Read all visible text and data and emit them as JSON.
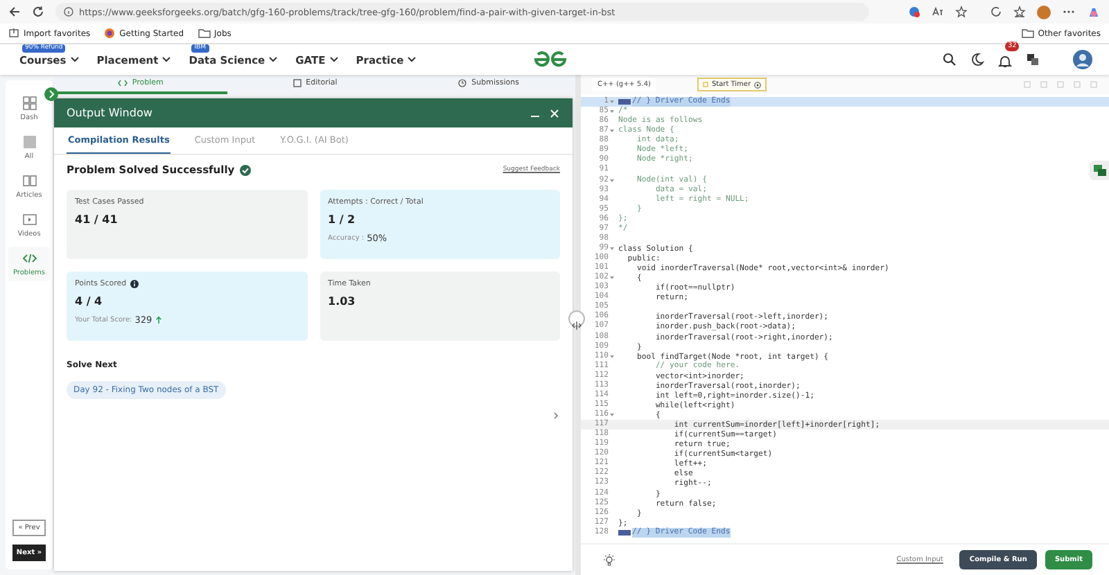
{
  "browser": {
    "url": "https://www.geeksforgeeks.org/batch/gfg-160-problems/track/tree-gfg-160/problem/find-a-pair-with-given-target-in-bst",
    "bookmarks": [
      {
        "label": "Import favorites",
        "kind": "import"
      },
      {
        "label": "Getting Started",
        "kind": "site"
      },
      {
        "label": "Jobs",
        "kind": "folder"
      }
    ],
    "other_bookmarks": "Other favorites"
  },
  "nav": {
    "items": [
      {
        "label": "Courses",
        "badge": "90% Refund"
      },
      {
        "label": "Placement"
      },
      {
        "label": "Data Science",
        "badge": "IBM"
      },
      {
        "label": "GATE"
      },
      {
        "label": "Practice"
      }
    ],
    "notification_count": "32"
  },
  "sidebar": {
    "items": [
      {
        "label": "Dash",
        "selected": false
      },
      {
        "label": "All",
        "selected": false
      },
      {
        "label": "Articles",
        "selected": false
      },
      {
        "label": "Videos",
        "selected": false
      },
      {
        "label": "Problems",
        "selected": true
      }
    ],
    "prev": "« Prev",
    "next": "Next »"
  },
  "problem_tabs": [
    {
      "label": "Problem",
      "selected": true
    },
    {
      "label": "Editorial",
      "selected": false
    },
    {
      "label": "Submissions",
      "selected": false
    }
  ],
  "output_window": {
    "title": "Output Window",
    "tabs": [
      {
        "label": "Compilation Results",
        "selected": true
      },
      {
        "label": "Custom Input",
        "selected": false
      },
      {
        "label": "Y.O.G.I. (AI Bot)",
        "selected": false
      }
    ],
    "status": "Problem Solved Successfully",
    "feedback_link": "Suggest Feedback",
    "cards": [
      {
        "label": "Test Cases Passed",
        "value": "41 / 41",
        "highlighted": false,
        "info": false
      },
      {
        "label": "Attempts : Correct / Total",
        "value": "1 / 2",
        "highlighted": true,
        "info": false,
        "note_label": "Accuracy :",
        "note_value": "50%",
        "trend_up": false
      },
      {
        "label": "Points Scored",
        "value": "4 / 4",
        "highlighted": true,
        "info": true,
        "note_label": "Your Total Score:",
        "note_value": "329",
        "trend_up": true
      },
      {
        "label": "Time Taken",
        "value": "1.03",
        "highlighted": false,
        "info": false
      }
    ],
    "solve_next": {
      "heading": "Solve Next",
      "items": [
        "Day 92 - Fixing Two nodes of a BST"
      ]
    }
  },
  "editor": {
    "language": "C++ (g++ 5.4)",
    "timer_button": "Start Timer",
    "custom_input": "Custom Input",
    "compile_button": "Compile & Run",
    "submit_button": "Submit",
    "lines": [
      {
        "num": "1",
        "text": "// } Driver Code Ends",
        "kind": "folded",
        "foldable": true,
        "highlighted": true,
        "cursor": false
      },
      {
        "num": "85",
        "text": "/*",
        "kind": "comment",
        "foldable": true,
        "highlighted": false,
        "cursor": false
      },
      {
        "num": "86",
        "text": "Node is as follows",
        "kind": "comment",
        "foldable": false,
        "highlighted": false,
        "cursor": false
      },
      {
        "num": "87",
        "text": "class Node {",
        "kind": "comment",
        "foldable": true,
        "highlighted": false,
        "cursor": false
      },
      {
        "num": "88",
        "text": "    int data;",
        "kind": "comment",
        "foldable": false,
        "highlighted": false,
        "cursor": false
      },
      {
        "num": "89",
        "text": "    Node *left;",
        "kind": "comment",
        "foldable": false,
        "highlighted": false,
        "cursor": false
      },
      {
        "num": "90",
        "text": "    Node *right;",
        "kind": "comment",
        "foldable": false,
        "highlighted": false,
        "cursor": false
      },
      {
        "num": "91",
        "kind": "comment",
        "foldable": false,
        "highlighted": false,
        "cursor": false
      },
      {
        "num": "92",
        "text": "    Node(int val) {",
        "kind": "comment",
        "foldable": true,
        "highlighted": false,
        "cursor": false
      },
      {
        "num": "93",
        "text": "        data = val;",
        "kind": "comment",
        "foldable": false,
        "highlighted": false,
        "cursor": false
      },
      {
        "num": "94",
        "text": "        left = right = NULL;",
        "kind": "comment",
        "foldable": false,
        "highlighted": false,
        "cursor": false
      },
      {
        "num": "95",
        "text": "    }",
        "kind": "comment",
        "foldable": false,
        "highlighted": false,
        "cursor": false
      },
      {
        "num": "96",
        "text": "};",
        "kind": "comment",
        "foldable": false,
        "highlighted": false,
        "cursor": false
      },
      {
        "num": "97",
        "text": "*/",
        "kind": "comment",
        "foldable": false,
        "highlighted": false,
        "cursor": false
      },
      {
        "num": "98",
        "kind": "code",
        "foldable": false,
        "highlighted": false,
        "cursor": false
      },
      {
        "num": "99",
        "text": "class Solution {",
        "kind": "code",
        "foldable": true,
        "highlighted": false,
        "cursor": false
      },
      {
        "num": "100",
        "text": "  public:",
        "kind": "code",
        "foldable": false,
        "highlighted": false,
        "cursor": false
      },
      {
        "num": "101",
        "text": "    void inorderTraversal(Node* root,vector<int>& inorder)",
        "kind": "code",
        "foldable": false,
        "highlighted": false,
        "cursor": false
      },
      {
        "num": "102",
        "text": "    {",
        "kind": "code",
        "foldable": true,
        "highlighted": false,
        "cursor": false
      },
      {
        "num": "103",
        "text": "        if(root==nullptr)",
        "kind": "code",
        "foldable": false,
        "highlighted": false,
        "cursor": false
      },
      {
        "num": "104",
        "text": "        return;",
        "kind": "code",
        "foldable": false,
        "highlighted": false,
        "cursor": false
      },
      {
        "num": "105",
        "kind": "code",
        "foldable": false,
        "highlighted": false,
        "cursor": false
      },
      {
        "num": "106",
        "text": "        inorderTraversal(root->left,inorder);",
        "kind": "code",
        "foldable": false,
        "highlighted": false,
        "cursor": false
      },
      {
        "num": "107",
        "text": "        inorder.push_back(root->data);",
        "kind": "code",
        "foldable": false,
        "highlighted": false,
        "cursor": false
      },
      {
        "num": "108",
        "text": "        inorderTraversal(root->right,inorder);",
        "kind": "code",
        "foldable": false,
        "highlighted": false,
        "cursor": false
      },
      {
        "num": "109",
        "text": "    }",
        "kind": "code",
        "foldable": false,
        "highlighted": false,
        "cursor": false
      },
      {
        "num": "110",
        "text": "    bool findTarget(Node *root, int target) {",
        "kind": "code",
        "foldable": true,
        "highlighted": false,
        "cursor": false
      },
      {
        "num": "111",
        "text": "        // your code here.",
        "kind": "comment",
        "foldable": false,
        "highlighted": false,
        "cursor": false
      },
      {
        "num": "112",
        "text": "        vector<int>inorder;",
        "kind": "code",
        "foldable": false,
        "highlighted": false,
        "cursor": false
      },
      {
        "num": "113",
        "text": "        inorderTraversal(root,inorder);",
        "kind": "code",
        "foldable": false,
        "highlighted": false,
        "cursor": false
      },
      {
        "num": "114",
        "text": "        int left=0,right=inorder.size()-1;",
        "kind": "code",
        "foldable": false,
        "highlighted": false,
        "cursor": false
      },
      {
        "num": "115",
        "text": "        while(left<right)",
        "kind": "code",
        "foldable": false,
        "highlighted": false,
        "cursor": false
      },
      {
        "num": "116",
        "text": "        {",
        "kind": "code",
        "foldable": true,
        "highlighted": false,
        "cursor": false
      },
      {
        "num": "117",
        "text": "            int currentSum=inorder[left]+inorder[right];",
        "kind": "code",
        "foldable": false,
        "highlighted": false,
        "cursor": true
      },
      {
        "num": "118",
        "text": "            if(currentSum==target)",
        "kind": "code",
        "foldable": false,
        "highlighted": false,
        "cursor": false
      },
      {
        "num": "119",
        "text": "            return true;",
        "kind": "code",
        "foldable": false,
        "highlighted": false,
        "cursor": false
      },
      {
        "num": "120",
        "text": "            if(currentSum<target)",
        "kind": "code",
        "foldable": false,
        "highlighted": false,
        "cursor": false
      },
      {
        "num": "121",
        "text": "            left++;",
        "kind": "code",
        "foldable": false,
        "highlighted": false,
        "cursor": false
      },
      {
        "num": "122",
        "text": "            else",
        "kind": "code",
        "foldable": false,
        "highlighted": false,
        "cursor": false
      },
      {
        "num": "123",
        "text": "            right--;",
        "kind": "code",
        "foldable": false,
        "highlighted": false,
        "cursor": false
      },
      {
        "num": "124",
        "text": "        }",
        "kind": "code",
        "foldable": false,
        "highlighted": false,
        "cursor": false
      },
      {
        "num": "125",
        "text": "        return false;",
        "kind": "code",
        "foldable": false,
        "highlighted": false,
        "cursor": false
      },
      {
        "num": "126",
        "text": "    }",
        "kind": "code",
        "foldable": false,
        "highlighted": false,
        "cursor": false
      },
      {
        "num": "127",
        "text": "};",
        "kind": "code",
        "foldable": false,
        "highlighted": false,
        "cursor": false
      },
      {
        "num": "128",
        "text": "// } Driver Code Ends",
        "kind": "folded",
        "foldable": false,
        "highlighted": false,
        "cursor": false
      }
    ]
  }
}
